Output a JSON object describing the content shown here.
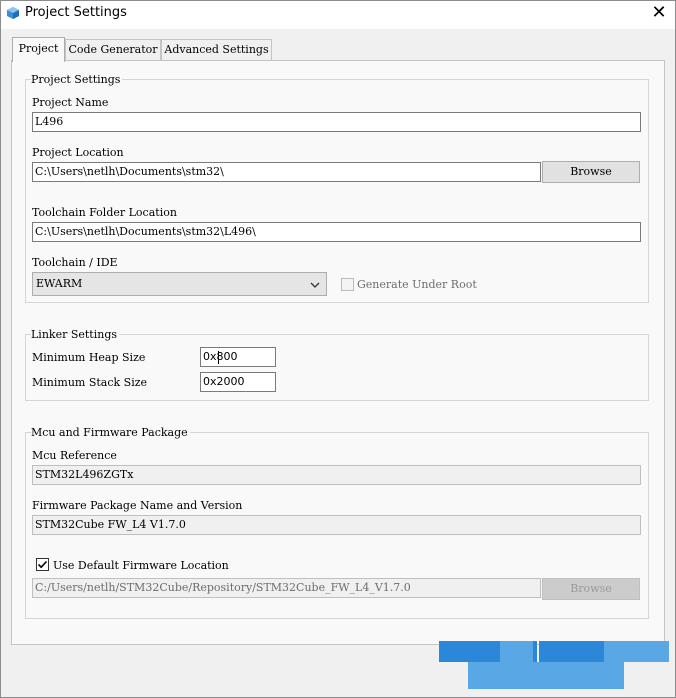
{
  "window": {
    "title": "Project Settings"
  },
  "tabs": [
    {
      "label": "Project"
    },
    {
      "label": "Code Generator"
    },
    {
      "label": "Advanced Settings"
    }
  ],
  "project_settings": {
    "group_title": "Project Settings",
    "name_label": "Project Name",
    "name_value": "L496",
    "location_label": "Project Location",
    "location_value": "C:\\Users\\netlh\\Documents\\stm32\\",
    "browse_label": "Browse",
    "toolchain_folder_label": "Toolchain Folder Location",
    "toolchain_folder_value": "C:\\Users\\netlh\\Documents\\stm32\\L496\\",
    "toolchain_label": "Toolchain / IDE",
    "toolchain_value": "EWARM",
    "generate_under_root_label": "Generate Under Root",
    "generate_under_root_checked": false
  },
  "linker_settings": {
    "group_title": "Linker Settings",
    "heap_label": "Minimum Heap Size",
    "heap_value": "0x800",
    "stack_label": "Minimum Stack Size",
    "stack_value": "0x2000"
  },
  "mcu_package": {
    "group_title": "Mcu and Firmware Package",
    "mcu_ref_label": "Mcu Reference",
    "mcu_ref_value": "STM32L496ZGTx",
    "fw_label": "Firmware Package Name and Version",
    "fw_value": "STM32Cube FW_L4 V1.7.0",
    "use_default_label": "Use Default Firmware Location",
    "use_default_checked": true,
    "fw_location_value": "C:/Users/netlh/STM32Cube/Repository/STM32Cube_FW_L4_V1.7.0",
    "browse_label": "Browse"
  },
  "colors": {
    "accent": "#2b88d8",
    "accent_light": "#5aa7e6"
  }
}
